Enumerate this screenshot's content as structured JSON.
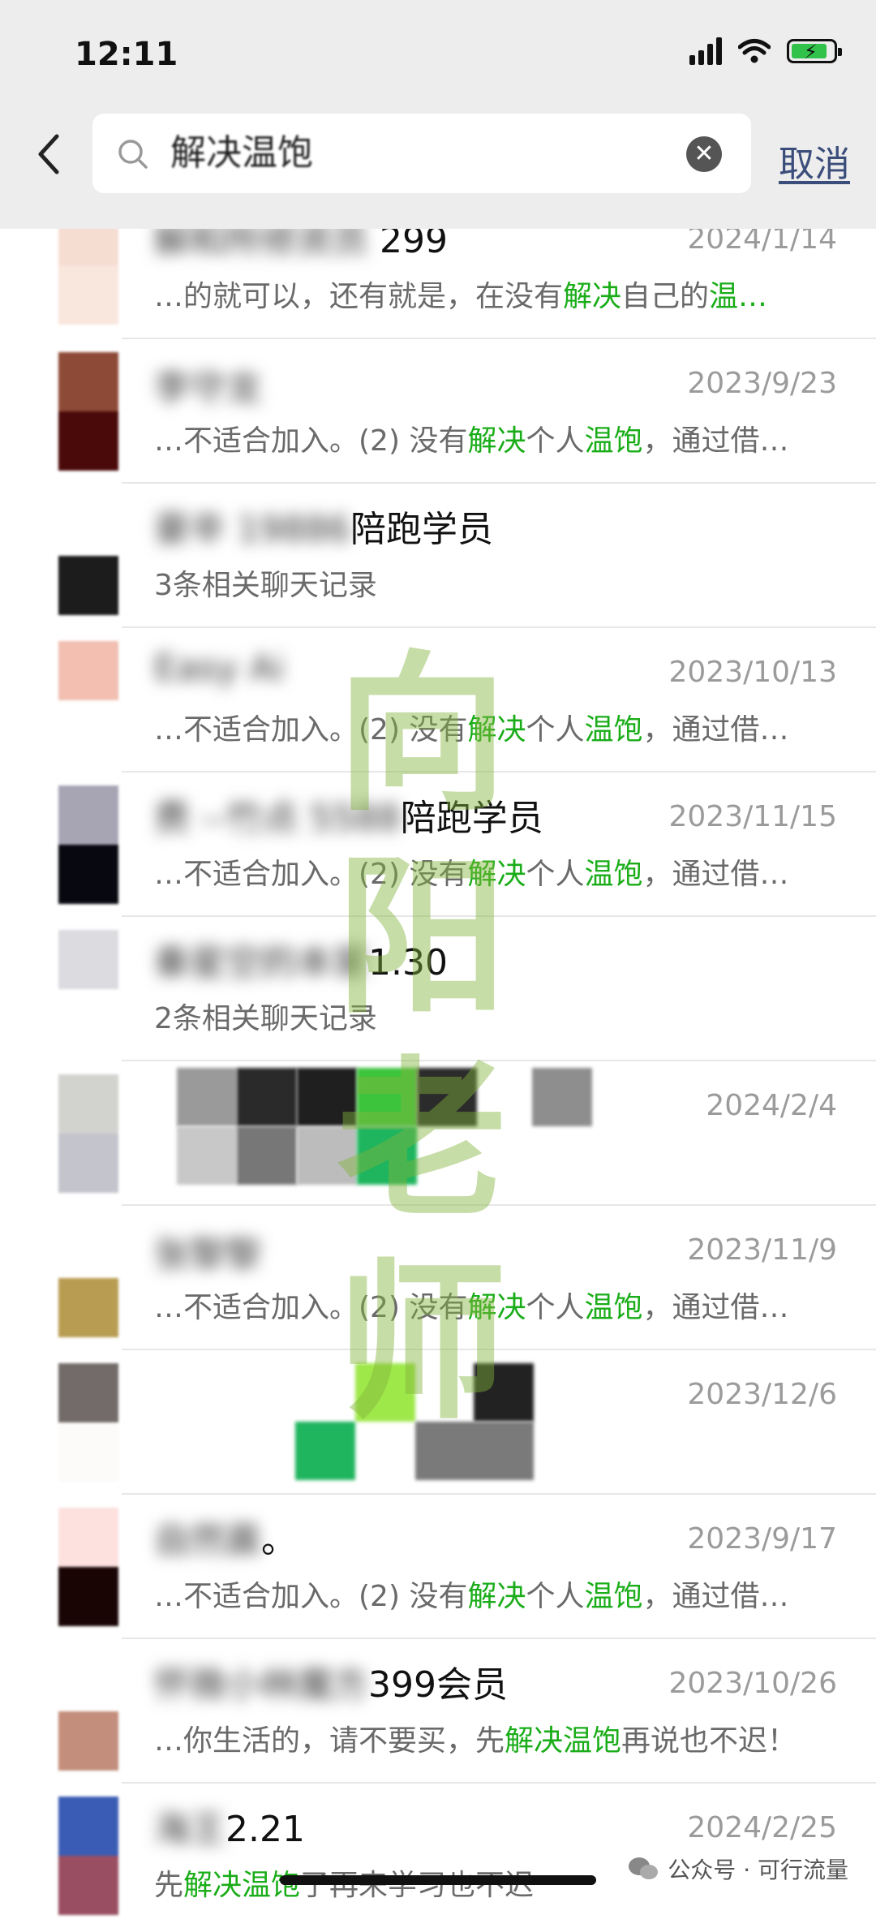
{
  "status_bar": {
    "time": "12:11"
  },
  "search": {
    "query": "解决温饱",
    "cancel_label": "取消"
  },
  "results": [
    {
      "name_blurred": "解和所修资员",
      "name_visible": " 299",
      "date": "2024/1/14",
      "snippet_parts": [
        "…的就可以，还有就是，在没有",
        "解决",
        "自己的",
        "温…"
      ]
    },
    {
      "name_blurred": "李守龙",
      "name_visible": "",
      "date": "2023/9/23",
      "snippet_parts": [
        "…不适合加入。(2) 没有",
        "解决",
        "个人",
        "温饱",
        "，通过借…"
      ]
    },
    {
      "name_blurred": "豪辛 19886",
      "name_visible": "陪跑学员",
      "date": "",
      "snippet_plain": "3条相关聊天记录"
    },
    {
      "name_blurred": "Easy Ai",
      "name_visible": "",
      "date": "2023/10/13",
      "snippet_parts": [
        "…不适合加入。(2) 没有",
        "解决",
        "个人",
        "温饱",
        "，通过借…"
      ]
    },
    {
      "name_blurred": "费 --竹点 5588",
      "name_visible": "陪跑学员",
      "date": "2023/11/15",
      "snippet_parts": [
        "…不适合加入。(2) 没有",
        "解决",
        "个人",
        "温饱",
        "，通过借…"
      ]
    },
    {
      "name_blurred": "秦星空的本家",
      "name_visible": "1.30",
      "date": "",
      "snippet_plain": "2条相关聊天记录"
    },
    {
      "name_blurred": "",
      "name_visible": "",
      "date": "2024/2/4",
      "snippet_plain": ""
    },
    {
      "name_blurred": "张黎黎",
      "name_visible": "",
      "date": "2023/11/9",
      "snippet_parts": [
        "…不适合加入。(2) 没有",
        "解决",
        "个人",
        "温饱",
        "，通过借…"
      ]
    },
    {
      "name_blurred": "",
      "name_visible": "",
      "date": "2023/12/6",
      "snippet_plain": ""
    },
    {
      "name_blurred": "自然晨",
      "name_visible": "。",
      "date": "2023/9/17",
      "snippet_parts": [
        "…不适合加入。(2) 没有",
        "解决",
        "个人",
        "温饱",
        "，通过借…"
      ]
    },
    {
      "name_blurred": "怀微小林魔方",
      "name_visible": "399会员",
      "date": "2023/10/26",
      "snippet_parts": [
        "…你生活的，请不要买，先",
        "解决",
        "温饱",
        "再说也不迟！",
        ""
      ]
    },
    {
      "name_blurred": "海王",
      "name_visible": "2.21",
      "date": "2024/2/25",
      "snippet_parts": [
        "先",
        "解决",
        "温饱",
        "了再来学习也不迟",
        ""
      ]
    }
  ],
  "watermark": {
    "line1": "向",
    "line2": "阳",
    "line3": "老",
    "line4": "师"
  },
  "footer": {
    "source": "公众号 · 可行流量"
  },
  "avatar_colors": [
    [
      "#f5ddd2",
      "#f9e6dd"
    ],
    [
      "#8d4a36",
      "#4a0a0a"
    ],
    [
      "#ffffff",
      "#1c1c1c"
    ],
    [
      "#f2bfb1",
      "#ffffff"
    ],
    [
      "#a7a4b4",
      "#080810"
    ],
    [
      "#dcdbe0",
      "#ffffff"
    ],
    [
      "#d2d3cf",
      "#c4c4cc"
    ],
    [
      "#ffffff",
      "#b89c52"
    ],
    [
      "#736b69",
      "#fcfbfa"
    ],
    [
      "#fce1df",
      "#1a0505"
    ],
    [
      "#ffffff",
      "#c38e7b"
    ],
    [
      "#3a5cb4",
      "#9a4e62"
    ]
  ]
}
